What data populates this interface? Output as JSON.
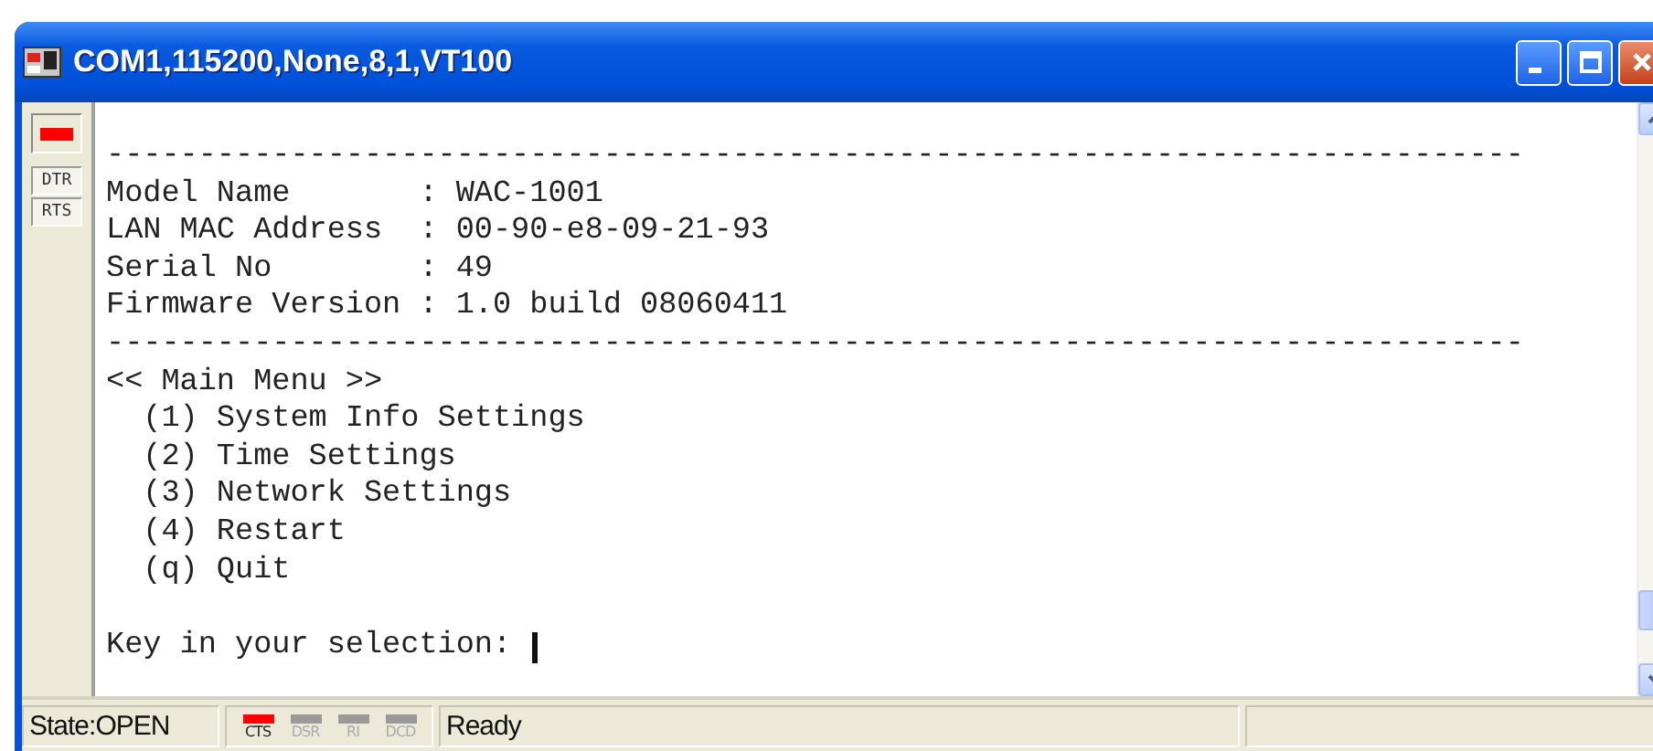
{
  "window": {
    "title": "COM1,115200,None,8,1,VT100"
  },
  "side_panel": {
    "led": {
      "on": true
    },
    "buttons": [
      {
        "label": "DTR"
      },
      {
        "label": "RTS"
      }
    ]
  },
  "terminal": {
    "lines": [
      {
        "text": "-----------------------------------------------------------------------------"
      },
      {
        "text": "Model Name       : WAC-1001"
      },
      {
        "text": "LAN MAC Address  : 00-90-e8-09-21-93"
      },
      {
        "text": "Serial No        : 49"
      },
      {
        "text": "Firmware Version : 1.0 build 08060411"
      },
      {
        "text": "-----------------------------------------------------------------------------"
      },
      {
        "text": "<< Main Menu >>"
      },
      {
        "text": "  (1) System Info Settings"
      },
      {
        "text": "  (2) Time Settings"
      },
      {
        "text": "  (3) Network Settings"
      },
      {
        "text": "  (4) Restart"
      },
      {
        "text": "  (q) Quit"
      }
    ],
    "prompt": "Key in your selection: "
  },
  "status_bar": {
    "state": "State:OPEN",
    "signals": [
      {
        "label": "CTS",
        "on": true
      },
      {
        "label": "DSR",
        "on": false
      },
      {
        "label": "RI",
        "on": false
      },
      {
        "label": "DCD",
        "on": false
      }
    ],
    "message": "Ready"
  }
}
